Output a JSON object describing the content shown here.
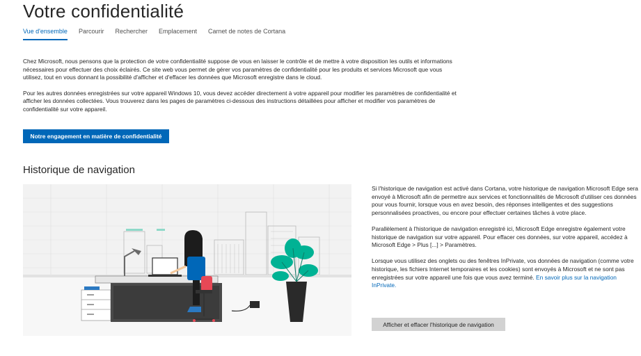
{
  "header": {
    "title": "Votre confidentialité"
  },
  "tabs": [
    {
      "label": "Vue d'ensemble",
      "active": true
    },
    {
      "label": "Parcourir",
      "active": false
    },
    {
      "label": "Rechercher",
      "active": false
    },
    {
      "label": "Emplacement",
      "active": false
    },
    {
      "label": "Carnet de notes de Cortana",
      "active": false
    }
  ],
  "intro": {
    "paragraph1": "Chez Microsoft, nous pensons que la protection de votre confidentialité suppose de vous en laisser le contrôle et de mettre à votre disposition les outils et informations nécessaires pour effectuer des choix éclairés. Ce site web vous permet de gérer vos paramètres de confidentialité pour les produits et services Microsoft que vous utilisez, tout en vous donnant la possibilité d'afficher et d'effacer les données que Microsoft enregistre dans le cloud.",
    "paragraph2": "Pour les autres données enregistrées sur votre appareil Windows 10, vous devez accéder directement à votre appareil pour modifier les paramètres de confidentialité et afficher les données collectées. Vous trouverez dans les pages de paramètres ci-dessous des instructions détaillées pour afficher et modifier vos paramètres de confidentialité sur votre appareil."
  },
  "primary_button": "Notre engagement en matière de confidentialité",
  "browsing": {
    "title": "Historique de navigation",
    "paragraph1": "Si l'historique de navigation est activé dans Cortana, votre historique de navigation Microsoft Edge sera envoyé à Microsoft afin de permettre aux services et fonctionnalités de Microsoft d'utiliser ces données pour vous fournir, lorsque vous en avez besoin, des réponses intelligentes et des suggestions personnalisées proactives, ou encore pour effectuer certaines tâches à votre place.",
    "paragraph2": "Parallèlement à l'historique de navigation enregistré ici, Microsoft Edge enregistre également votre historique de navigation sur votre appareil. Pour effacer ces données, sur votre appareil, accédez à Microsoft Edge > Plus [...] > Paramètres.",
    "paragraph3": "Lorsque vous utilisez des onglets ou des fenêtres InPrivate, vos données de navigation (comme votre historique, les fichiers Internet temporaires et les cookies) sont envoyés à Microsoft et ne sont pas enregistrées sur votre appareil une fois que vous avez terminé.",
    "link": "En savoir plus sur la navigation InPrivate.",
    "button": "Afficher et effacer l'historique de navigation"
  },
  "colors": {
    "accent": "#0067b8",
    "illustration_bg": "#f2f2f2",
    "plant": "#00b294",
    "chair": "#e74856",
    "secondary_button": "#d2d2d2"
  }
}
